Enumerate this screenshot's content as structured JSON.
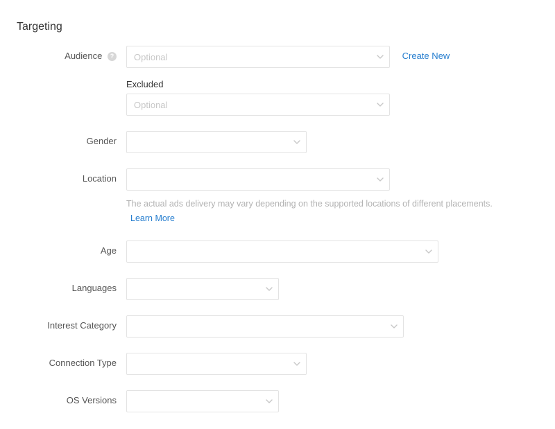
{
  "section_title": "Targeting",
  "labels": {
    "audience": "Audience",
    "excluded": "Excluded",
    "gender": "Gender",
    "location": "Location",
    "age": "Age",
    "languages": "Languages",
    "interest_category": "Interest Category",
    "connection_type": "Connection Type",
    "os_versions": "OS Versions"
  },
  "placeholders": {
    "audience": "Optional",
    "excluded": "Optional"
  },
  "links": {
    "create_new": "Create New",
    "learn_more": "Learn More"
  },
  "hints": {
    "location": "The actual ads delivery may vary depending on the supported locations of different placements."
  },
  "icons": {
    "help_glyph": "?"
  }
}
